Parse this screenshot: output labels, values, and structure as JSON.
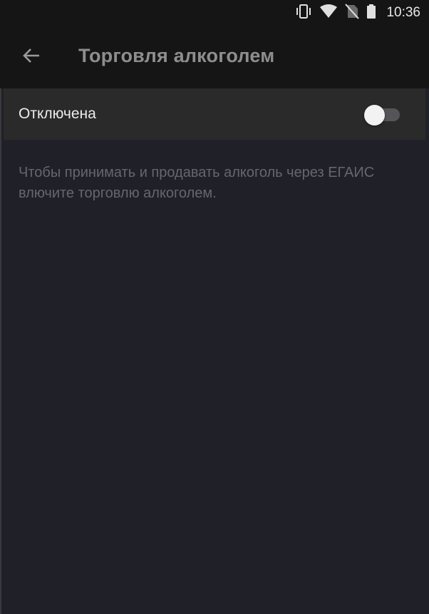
{
  "status_bar": {
    "time": "10:36",
    "icons": [
      "vibrate-icon",
      "wifi-icon",
      "no-sim-icon",
      "battery-icon"
    ]
  },
  "app_bar": {
    "back_icon": "arrow-back-icon",
    "title": "Торговля алкоголем"
  },
  "setting": {
    "label": "Отключена",
    "enabled": false
  },
  "description": "Чтобы принимать и продавать алкоголь через ЕГАИС влючите торговлю алкоголем.",
  "colors": {
    "background": "#202028",
    "app_bar": "#151515",
    "row": "#2a2a2a",
    "title_text": "#8e8e8e",
    "description_text": "#66666e"
  }
}
